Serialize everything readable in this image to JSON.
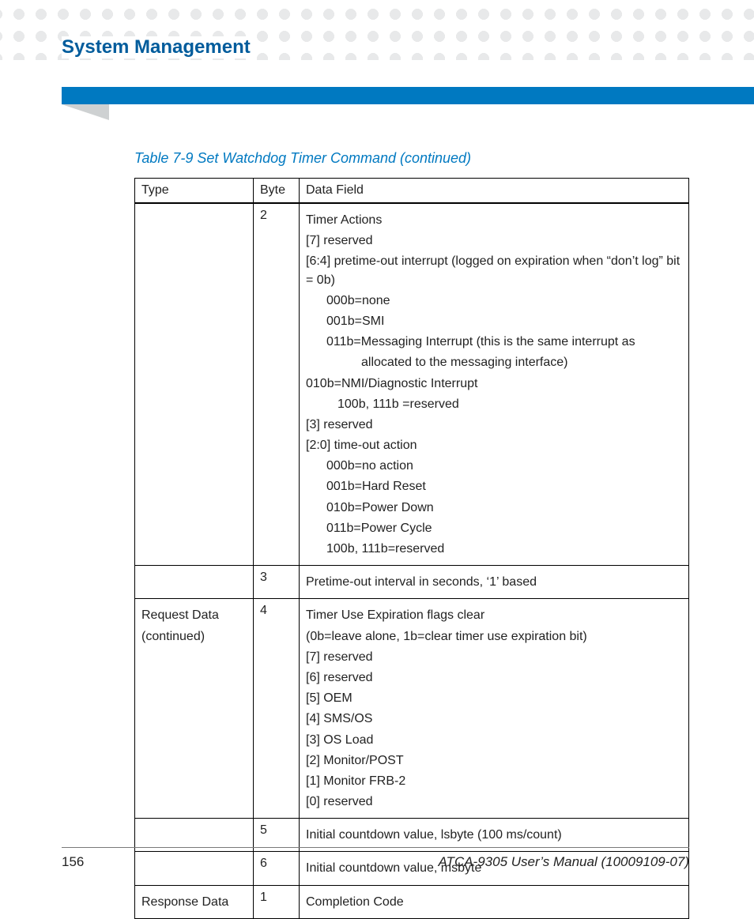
{
  "header": {
    "chapter_title": "System Management"
  },
  "table": {
    "caption": "Table 7-9 Set Watchdog Timer Command (continued)",
    "headers": {
      "type": "Type",
      "byte": "Byte",
      "data_field": "Data Field"
    },
    "rows": [
      {
        "type": "",
        "byte": "2",
        "lines": [
          {
            "text": "Timer Actions",
            "indent": ""
          },
          {
            "text": "[7] reserved",
            "indent": ""
          },
          {
            "text": "[6:4] pretime-out interrupt (logged on expiration when “don’t log” bit = 0b)",
            "indent": ""
          },
          {
            "text": "000b=none",
            "indent": "ind1"
          },
          {
            "text": "001b=SMI",
            "indent": "ind1"
          },
          {
            "text": "011b=Messaging Interrupt (this is the same interrupt as",
            "indent": "ind1"
          },
          {
            "text": "allocated to the messaging interface)",
            "indent": "ind2"
          },
          {
            "text": "010b=NMI/Diagnostic Interrupt",
            "indent": ""
          },
          {
            "text": "100b, 111b =reserved",
            "indent": "ind0b"
          },
          {
            "text": "[3] reserved",
            "indent": ""
          },
          {
            "text": "[2:0] time-out action",
            "indent": ""
          },
          {
            "text": "000b=no action",
            "indent": "ind1"
          },
          {
            "text": "001b=Hard Reset",
            "indent": "ind1"
          },
          {
            "text": "010b=Power Down",
            "indent": "ind1"
          },
          {
            "text": "011b=Power Cycle",
            "indent": "ind1"
          },
          {
            "text": "100b, 111b=reserved",
            "indent": "ind1"
          }
        ]
      },
      {
        "type": "",
        "byte": "3",
        "lines": [
          {
            "text": "Pretime-out interval in seconds, ‘1’ based",
            "indent": ""
          }
        ]
      },
      {
        "type": "Request Data (continued)",
        "byte": "4",
        "lines": [
          {
            "text": "Timer Use Expiration flags clear",
            "indent": ""
          },
          {
            "text": "(0b=leave alone, 1b=clear timer use expiration bit)",
            "indent": ""
          },
          {
            "text": "[7] reserved",
            "indent": ""
          },
          {
            "text": "[6] reserved",
            "indent": ""
          },
          {
            "text": "[5] OEM",
            "indent": ""
          },
          {
            "text": "[4] SMS/OS",
            "indent": ""
          },
          {
            "text": "[3] OS Load",
            "indent": ""
          },
          {
            "text": "[2] Monitor/POST",
            "indent": ""
          },
          {
            "text": "[1] Monitor FRB-2",
            "indent": ""
          },
          {
            "text": "[0] reserved",
            "indent": ""
          }
        ]
      },
      {
        "type": "",
        "byte": "5",
        "lines": [
          {
            "text": "Initial countdown value, lsbyte (100 ms/count)",
            "indent": ""
          }
        ]
      },
      {
        "type": "",
        "byte": "6",
        "lines": [
          {
            "text": "Initial countdown value, msbyte",
            "indent": ""
          }
        ]
      },
      {
        "type": "Response Data",
        "byte": "1",
        "lines": [
          {
            "text": "Completion Code",
            "indent": ""
          }
        ]
      }
    ]
  },
  "footer": {
    "page_number": "156",
    "doc_title": "ATCA-9305 User’s Manual (10009109-07)"
  }
}
